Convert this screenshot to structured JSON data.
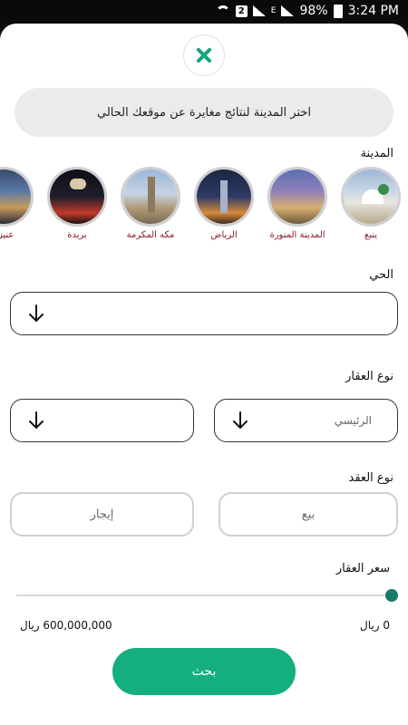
{
  "status_bar": {
    "time": "3:24 PM",
    "battery": "98%",
    "sim_badge": "2",
    "network_badge": "E"
  },
  "colors": {
    "accent": "#14ae7f",
    "close_icon": "#16a47b",
    "city_label": "#8a1a2c",
    "slider_thumb": "#187a6c"
  },
  "sheet": {
    "close_icon": "close-x-icon",
    "info_message": "اختر المدينة لنتائج مغايرة عن موقعك الحالي",
    "city_section_label": "المدينة",
    "cities": [
      {
        "name": "ينبع"
      },
      {
        "name": "المدينة المنورة"
      },
      {
        "name": "الرياض"
      },
      {
        "name": "مكه المكرمة"
      },
      {
        "name": "بريدة"
      },
      {
        "name": "عنيزة"
      }
    ],
    "district_label": "الحي",
    "property_type_label": "نوع العقار",
    "property_type_value": "الرئيسي",
    "contract_type_label": "نوع العقد",
    "contract_options": [
      "بيع",
      "إيجار"
    ],
    "price_label": "سعر العقار",
    "price_min": "0 ريال",
    "price_max": "600,000,000 ريال",
    "price_fraction": 1.0,
    "search_button": "بحث"
  }
}
